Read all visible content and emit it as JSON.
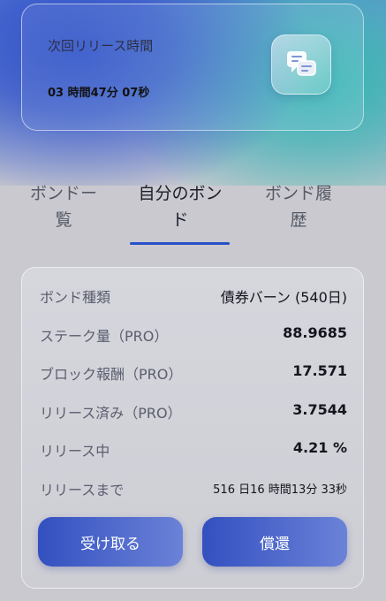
{
  "release_card": {
    "title": "次回リリース時間",
    "countdown": "03 時間47分 07秒",
    "icon": "chat-bubbles-icon"
  },
  "tabs": [
    {
      "line1": "ボンドー",
      "line2": "覧",
      "active": false
    },
    {
      "line1": "自分のボン",
      "line2": "ド",
      "active": true
    },
    {
      "line1": "ボンド履",
      "line2": "歴",
      "active": false
    }
  ],
  "details": {
    "rows": [
      {
        "label": "ボンド種類",
        "value": "債券バーン (540日)"
      },
      {
        "label": "ステーク量（PRO）",
        "value": "88.9685"
      },
      {
        "label": "ブロック報酬（PRO）",
        "value": "17.571"
      },
      {
        "label": "リリース済み（PRO）",
        "value": "3.7544"
      },
      {
        "label": "リリース中",
        "value": "4.21 %"
      },
      {
        "label": "リリースまで",
        "value": "516 日16 時間13分 33秒"
      }
    ],
    "claim_button": "受け取る",
    "redeem_button": "償還"
  },
  "colors": {
    "accent": "#2850c8",
    "button_gradient_start": "#3350c0",
    "button_gradient_end": "#6b82d8"
  }
}
